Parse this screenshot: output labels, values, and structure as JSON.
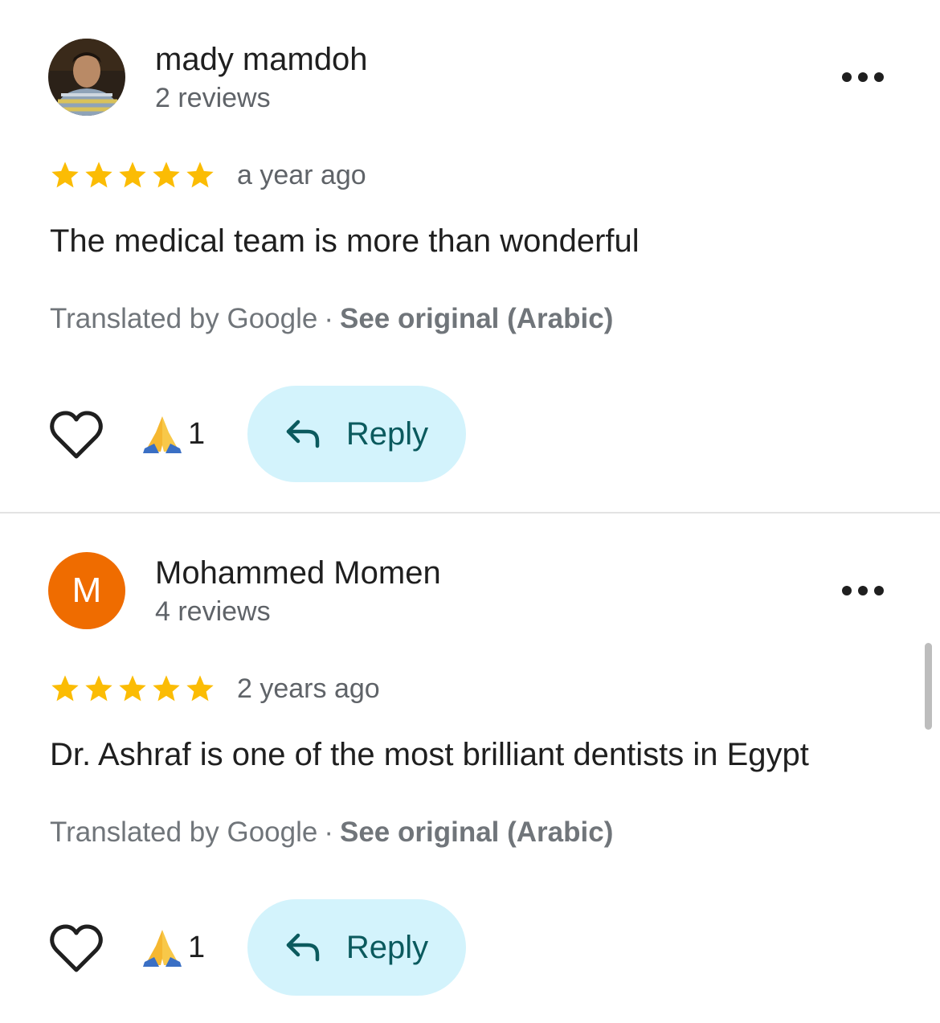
{
  "reviews": [
    {
      "author": "mady mamdoh",
      "review_count": "2 reviews",
      "avatar": {
        "type": "photo",
        "icon": "user-photo"
      },
      "rating": 5,
      "time": "a year ago",
      "text": "The medical team is more than wonderful",
      "translated_label": "Translated by Google",
      "separator": "·",
      "see_original": "See original (Arabic)",
      "reaction_count": "1",
      "reply_label": "Reply"
    },
    {
      "author": "Mohammed Momen",
      "review_count": "4 reviews",
      "avatar": {
        "type": "letter",
        "letter": "M",
        "color": "#ef6c00"
      },
      "rating": 5,
      "time": "2 years ago",
      "text": "Dr. Ashraf is one of the most brilliant dentists in Egypt",
      "translated_label": "Translated by Google",
      "separator": "·",
      "see_original": "See original (Arabic)",
      "reaction_count": "1",
      "reply_label": "Reply"
    }
  ],
  "colors": {
    "star": "#fbbc04",
    "reply_bg": "#d3f3fc",
    "reply_text": "#0b5a5e",
    "secondary_text": "#5f6368",
    "divider": "#e3e3e3"
  },
  "icons": [
    "more-options-icon",
    "star-icon",
    "heart-icon",
    "praying-hands-icon",
    "reply-arrow-icon"
  ]
}
